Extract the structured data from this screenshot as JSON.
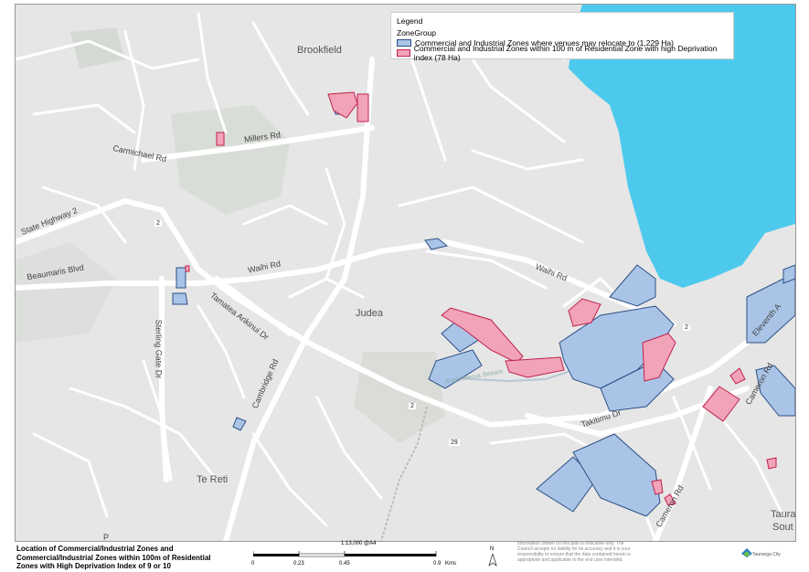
{
  "legend": {
    "title": "Legend",
    "group": "ZoneGroup",
    "items": [
      {
        "label": "Commercial and Industrial Zones where venues may relocate to (1,229 Ha)",
        "fill": "#a9c4e6",
        "stroke": "#2c4f86"
      },
      {
        "label": "Commercial and Industrial Zones within 100 m of Residential Zone with high Deprivation index (78 Ha)",
        "fill": "#f2a3b8",
        "stroke": "#c0204e"
      }
    ]
  },
  "places": {
    "brookfield": "Brookfield",
    "judea": "Judea",
    "te_reti": "Te Reti",
    "tauranga_south_1": "Taura",
    "tauranga_south_2": "Sout"
  },
  "roads": {
    "carmichael": "Carmichael Rd",
    "millers": "Millers Rd",
    "state_highway_2": "State Highway 2",
    "beaumaris": "Beaumaris Blvd",
    "waihi_west": "Waihi Rd",
    "waihi_east": "Waihi Rd",
    "tamatea": "Tamatea Arikinui Dr",
    "sterling_gate": "Sterling Gate Dr",
    "cambridge": "Cambridge Rd",
    "takitimu": "Takitimu Dr",
    "cameron_north": "Cameron Rd",
    "cameron_south": "Cameron Rd",
    "eleventh": "Eleventh A",
    "kopurererua": "Kopurererua Stream",
    "p_edge": "P"
  },
  "shields": {
    "s1": "2",
    "s2": "2",
    "s3": "2",
    "s4": "29"
  },
  "footer": {
    "title": "Location of Commercial/Industrial Zones and Commercial/Industrial Zones within 100m of Residential Zones with High Deprivation Index of 9 or 10",
    "scale_ratio": "1:13,000 @A4",
    "scale_ticks": [
      "0",
      "0.23",
      "0.45",
      "0.9"
    ],
    "scale_unit": "Kms",
    "north": "N",
    "disclaimer": "Information shown on this plan is indicative only. The Council accepts no liability for its accuracy and it is your responsibility to ensure that the data contained herein is appropriate and applicable to the end user intended.",
    "logo": "Tauranga City"
  },
  "colors": {
    "water": "#4ec9ee",
    "land": "#e6e6e6",
    "road": "#ffffff",
    "blue_fill": "#a9c4e6",
    "blue_stroke": "#2c4f86",
    "pink_fill": "#f2a3b8",
    "pink_stroke": "#c0204e",
    "green": "#d8dcd6"
  }
}
